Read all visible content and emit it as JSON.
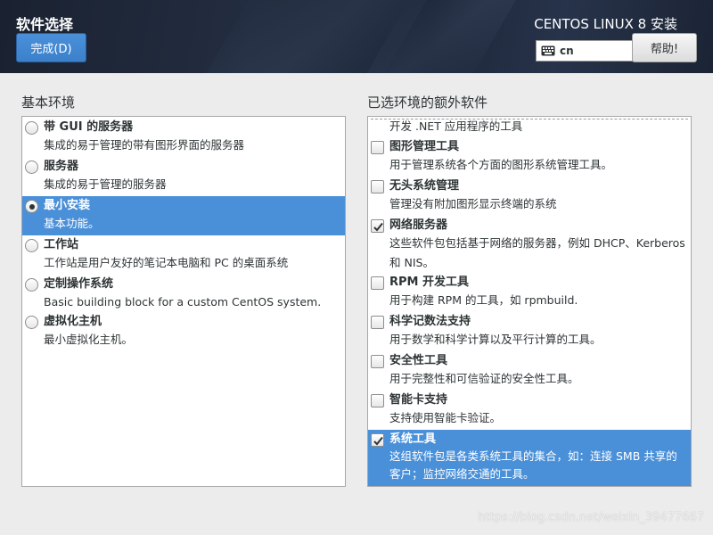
{
  "header": {
    "title": "软件选择",
    "done_label": "完成(D)",
    "product": "CENTOS LINUX 8 安装",
    "keyboard": "cn",
    "help_label": "帮助!"
  },
  "base_environment": {
    "label": "基本环境",
    "items": [
      {
        "name": "带 GUI 的服务器",
        "desc": "集成的易于管理的带有图形界面的服务器",
        "selected": false
      },
      {
        "name": "服务器",
        "desc": "集成的易于管理的服务器",
        "selected": false
      },
      {
        "name": "最小安装",
        "desc": "基本功能。",
        "selected": true
      },
      {
        "name": "工作站",
        "desc": "工作站是用户友好的笔记本电脑和 PC 的桌面系统",
        "selected": false
      },
      {
        "name": "定制操作系统",
        "desc": "Basic building block for a custom CentOS system.",
        "selected": false
      },
      {
        "name": "虚拟化主机",
        "desc": "最小虚拟化主机。",
        "selected": false
      }
    ]
  },
  "addons": {
    "label": "已选环境的额外软件",
    "partial_top_desc": "开发 .NET 应用程序的工具",
    "items": [
      {
        "name": "图形管理工具",
        "desc": "用于管理系统各个方面的图形系统管理工具。",
        "checked": false
      },
      {
        "name": "无头系统管理",
        "desc": "管理没有附加图形显示终端的系统",
        "checked": false
      },
      {
        "name": "网络服务器",
        "desc": "这些软件包包括基于网络的服务器，例如 DHCP、Kerberos 和 NIS。",
        "checked": true
      },
      {
        "name": "RPM 开发工具",
        "desc": "用于构建 RPM 的工具，如 rpmbuild.",
        "checked": false
      },
      {
        "name": "科学记数法支持",
        "desc": "用于数学和科学计算以及平行计算的工具。",
        "checked": false
      },
      {
        "name": "安全性工具",
        "desc": "用于完整性和可信验证的安全性工具。",
        "checked": false
      },
      {
        "name": "智能卡支持",
        "desc": "支持使用智能卡验证。",
        "checked": false
      },
      {
        "name": "系统工具",
        "desc": "这组软件包是各类系统工具的集合，如：连接 SMB 共享的客户；监控网络交通的工具。",
        "checked": true,
        "selected": true
      }
    ]
  },
  "watermark": "https://blog.csdn.net/weixin_39477667",
  "colors": {
    "accent": "#4a90d9",
    "header": "#1f2a3c"
  }
}
